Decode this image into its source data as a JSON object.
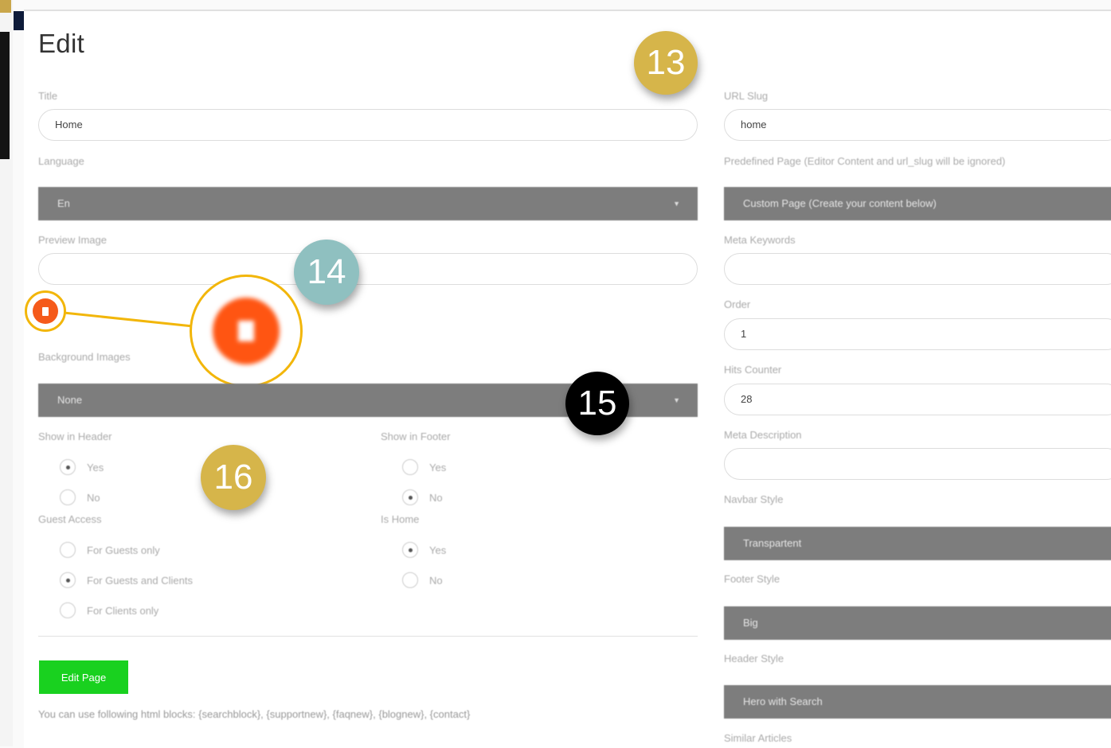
{
  "page": {
    "title": "Edit"
  },
  "form": {
    "title": {
      "label": "Title",
      "value": "Home"
    },
    "language": {
      "label": "Language",
      "value": "En"
    },
    "preview_image": {
      "label": "Preview Image",
      "value": ""
    },
    "background_images": {
      "label": "Background Images",
      "value": "None"
    },
    "show_in_header": {
      "label": "Show in Header",
      "options": [
        "Yes",
        "No"
      ],
      "selected": "Yes"
    },
    "show_in_footer": {
      "label": "Show in Footer",
      "options": [
        "Yes",
        "No"
      ],
      "selected": "No"
    },
    "guest_access": {
      "label": "Guest Access",
      "options": [
        "For Guests only",
        "For Guests and Clients",
        "For Clients only"
      ],
      "selected": "For Guests and Clients"
    },
    "is_home": {
      "label": "Is Home",
      "options": [
        "Yes",
        "No"
      ],
      "selected": "Yes"
    },
    "submit_label": "Edit Page",
    "hint": "You can use following html blocks: {searchblock}, {supportnew}, {faqnew}, {blognew}, {contact}",
    "url_slug": {
      "label": "URL Slug",
      "value": "home"
    },
    "predefined_page": {
      "label": "Predefined Page (Editor Content and url_slug will be ignored)",
      "value": "Custom Page (Create your content below)"
    },
    "meta_keywords": {
      "label": "Meta Keywords",
      "value": ""
    },
    "order": {
      "label": "Order",
      "value": "1"
    },
    "hits_counter": {
      "label": "Hits Counter",
      "value": "28"
    },
    "meta_description": {
      "label": "Meta Description",
      "value": ""
    },
    "navbar_style": {
      "label": "Navbar Style",
      "value": "Transpartent"
    },
    "footer_style": {
      "label": "Footer Style",
      "value": "Big"
    },
    "header_style": {
      "label": "Header Style",
      "value": "Hero with Search"
    },
    "similar_articles": {
      "label": "Similar Articles"
    }
  },
  "callouts": [
    {
      "number": "13",
      "color": "#d6b54a"
    },
    {
      "number": "14",
      "color": "#8fc0c0"
    },
    {
      "number": "15",
      "color": "#000000"
    },
    {
      "number": "16",
      "color": "#d6b54a"
    }
  ],
  "icons": {
    "uploaded_file_icon": "file-icon",
    "accent": "#f55a1b",
    "highlight_ring": "#f2b60a"
  }
}
